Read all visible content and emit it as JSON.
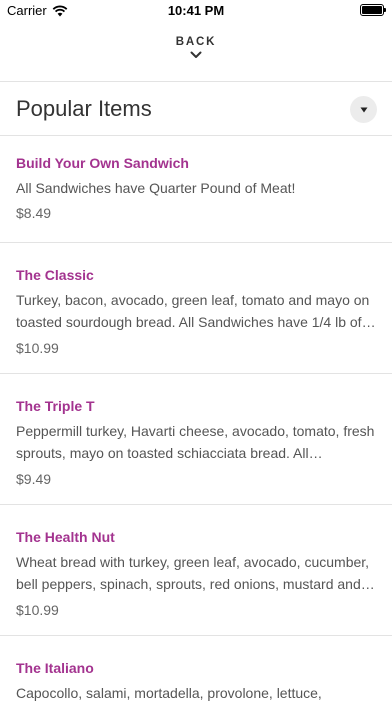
{
  "status_bar": {
    "carrier": "Carrier",
    "time": "10:41 PM",
    "wifi_icon": "wifi-icon",
    "battery_icon": "battery-icon"
  },
  "nav": {
    "back_label": "BACK",
    "back_icon": "chevron-down-icon"
  },
  "section": {
    "title": "Popular Items",
    "toggle_icon": "caret-down-icon"
  },
  "items": [
    {
      "name": "Build Your Own Sandwich",
      "description": "All Sandwiches have Quarter Pound of Meat!",
      "price": "$8.49"
    },
    {
      "name": "The Classic",
      "description": "Turkey, bacon, avocado, green leaf, tomato and mayo on toasted sourdough bread. All Sandwiches have 1/4 lb of…",
      "price": "$10.99"
    },
    {
      "name": "The Triple T",
      "description": "Peppermill turkey, Havarti cheese, avocado, tomato, fresh sprouts, mayo on toasted schiacciata bread. All Sandwic…",
      "price": "$9.49"
    },
    {
      "name": "The Health Nut",
      "description": "Wheat bread with turkey, green leaf, avocado, cucumber, bell peppers, spinach, sprouts, red onions, mustard and…",
      "price": "$10.99"
    },
    {
      "name": "The Italiano",
      "description": "Capocollo, salami, mortadella, provolone, lettuce,",
      "price": ""
    }
  ],
  "colors": {
    "accent": "#a3338f",
    "divider": "#e3e3e3"
  }
}
